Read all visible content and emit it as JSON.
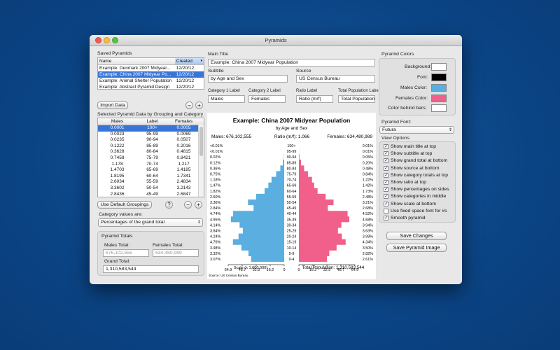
{
  "window": {
    "title": "Pyramids"
  },
  "saved": {
    "label": "Saved Pyramids",
    "col_name": "Name",
    "col_created": "Created",
    "rows": [
      {
        "name": "Example: Denmark 2007 Midyear...",
        "created": "12/20/12"
      },
      {
        "name": "Example: China 2007 Midyear Po...",
        "created": "12/20/12"
      },
      {
        "name": "Example: Animal Shelter Population",
        "created": "12/20/12"
      },
      {
        "name": "Example: Abstract Pyramid Design",
        "created": "12/20/12"
      }
    ],
    "selected_index": 1,
    "import_label": "Import Data"
  },
  "selected_data": {
    "label": "Selected Pyramid Data by Grouping and Category",
    "col_males": "Males",
    "col_label": "Label",
    "col_females": "Females",
    "rows": [
      {
        "males": "0.0001",
        "label": "100+",
        "females": "0.0005"
      },
      {
        "males": "0.0023",
        "label": "95-99",
        "females": "0.0069"
      },
      {
        "males": "0.0235",
        "label": "90-94",
        "females": "0.0507"
      },
      {
        "males": "0.1222",
        "label": "85-89",
        "females": "0.2016"
      },
      {
        "males": "0.3628",
        "label": "80-84",
        "females": "0.4815"
      },
      {
        "males": "0.7458",
        "label": "75-79",
        "females": "0.8421"
      },
      {
        "males": "1.178",
        "label": "70-74",
        "females": "1.217"
      },
      {
        "males": "1.4703",
        "label": "65-69",
        "females": "1.4185"
      },
      {
        "males": "1.8195",
        "label": "60-64",
        "females": "1.7341"
      },
      {
        "males": "2.6034",
        "label": "55-59",
        "females": "2.4834"
      },
      {
        "males": "3.3602",
        "label": "50-54",
        "females": "3.2143"
      },
      {
        "males": "2.8436",
        "label": "45-49",
        "females": "2.6847"
      }
    ],
    "default_groupings_label": "Use Default Groupings",
    "help_label": "?"
  },
  "category": {
    "label": "Category values are:",
    "value": "Percentages of the grand total"
  },
  "totals": {
    "label": "Pyramid Totals",
    "males_label": "Males Total:",
    "males_value": "676,102,555",
    "females_label": "Females Total:",
    "females_value": "634,480,989",
    "grand_label": "Grand Total:",
    "grand_value": "1,310,583,544"
  },
  "form": {
    "main_title_label": "Main Title",
    "main_title_value": "Example: China 2007 Midyear Population",
    "subtitle_label": "Subtitle",
    "subtitle_value": "by Age and Sex",
    "source_label": "Source",
    "source_value": "US Census Bureau",
    "cat1_label": "Category 1 Label",
    "cat1_value": "Males",
    "cat2_label": "Category 2 Label",
    "cat2_value": "Females",
    "ratio_label": "Ratio Label",
    "ratio_value": "Ratio (m/f)",
    "total_label": "Total Population Label",
    "total_value": "Total Population"
  },
  "colors": {
    "label": "Pyramid Colors",
    "background_label": "Background:",
    "font_label": "Font:",
    "males_label": "Males Color:",
    "females_label": "Females Color:",
    "bars_label": "Color behind bars:",
    "background": "#ffffff",
    "font": "#000000",
    "males": "#5aaee0",
    "females": "#f0608a",
    "bars": "#ffffff"
  },
  "font": {
    "label": "Pyramid Font:",
    "value": "Futura"
  },
  "view_options": {
    "label": "View Options",
    "items": [
      {
        "label": "Show main title at top",
        "checked": true
      },
      {
        "label": "Show subtitle at top",
        "checked": true
      },
      {
        "label": "Show grand total at bottom",
        "checked": true
      },
      {
        "label": "Show source at bottom",
        "checked": true
      },
      {
        "label": "Show category totals at top",
        "checked": true
      },
      {
        "label": "Show ratio at top",
        "checked": true
      },
      {
        "label": "Show percentages on sides",
        "checked": true
      },
      {
        "label": "Show categories in middle",
        "checked": true
      },
      {
        "label": "Show scale at bottom",
        "checked": true
      },
      {
        "label": "Use fixed space font for #s",
        "checked": false
      },
      {
        "label": "Smooth pyramid",
        "checked": true
      }
    ]
  },
  "actions": {
    "save_changes": "Save Changes",
    "save_image": "Save Pyramid Image"
  },
  "chart_data": {
    "type": "bar",
    "title": "Example: China 2007 Midyear Population",
    "subtitle": "by Age and Sex",
    "males_header": "Males: 676,102,555",
    "ratio_header": "Ratio (m/f): 1.066",
    "females_header": "Females: 634,480,989",
    "categories": [
      "100+",
      "95-99",
      "90-94",
      "85-89",
      "80-84",
      "75-79",
      "70-74",
      "65-69",
      "60-64",
      "55-59",
      "50-54",
      "45-49",
      "40-44",
      "35-39",
      "30-34",
      "25-29",
      "20-24",
      "15-19",
      "10-14",
      "5-9",
      "0-4"
    ],
    "males_pct_labels": [
      "<0.01%",
      "<0.01%",
      "0.02%",
      "0.12%",
      "0.36%",
      "0.75%",
      "1.18%",
      "1.47%",
      "1.82%",
      "2.60%",
      "3.36%",
      "2.84%",
      "4.74%",
      "4.95%",
      "4.14%",
      "3.84%",
      "4.24%",
      "4.76%",
      "3.98%",
      "3.32%",
      "3.07%"
    ],
    "females_pct_labels": [
      "0.01%",
      "0.01%",
      "0.05%",
      "0.20%",
      "0.48%",
      "0.84%",
      "1.22%",
      "1.42%",
      "1.73%",
      "2.48%",
      "3.21%",
      "2.68%",
      "4.52%",
      "4.68%",
      "3.94%",
      "3.63%",
      "3.99%",
      "4.34%",
      "3.50%",
      "2.82%",
      "2.61%"
    ],
    "series": [
      {
        "name": "Males",
        "values": [
          0.0001,
          0.0023,
          0.0235,
          0.1222,
          0.3628,
          0.7458,
          1.178,
          1.4703,
          1.8195,
          2.6034,
          3.3602,
          2.8436,
          4.74,
          4.95,
          4.14,
          3.84,
          4.24,
          4.76,
          3.98,
          3.32,
          3.07
        ]
      },
      {
        "name": "Females",
        "values": [
          0.0005,
          0.0069,
          0.0507,
          0.2016,
          0.4815,
          0.8421,
          1.217,
          1.4185,
          1.7341,
          2.4834,
          3.2143,
          2.6847,
          4.52,
          4.68,
          3.94,
          3.63,
          3.99,
          4.34,
          3.5,
          2.82,
          2.61
        ]
      }
    ],
    "axis_ticks_left": [
      "64.9",
      "48.7",
      "32.5",
      "16.2",
      "0"
    ],
    "axis_ticks_right": [
      "0",
      "16.2",
      "32.5",
      "48.7",
      "64.9"
    ],
    "xlabel": "Scale  (x 1,000,000)",
    "total_footer": "Total Population: 1,310,583,544",
    "source_footer": "Source: US Census Bureau"
  }
}
